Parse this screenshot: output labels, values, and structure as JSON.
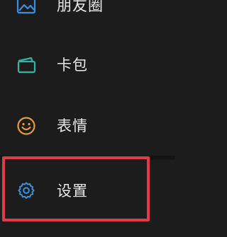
{
  "menu": {
    "items": [
      {
        "label": "朋友圈",
        "icon": "moments-icon"
      },
      {
        "label": "卡包",
        "icon": "card-wallet-icon"
      },
      {
        "label": "表情",
        "icon": "smiley-icon"
      },
      {
        "label": "设置",
        "icon": "gear-icon"
      }
    ]
  },
  "colors": {
    "background": "#1c1c1c",
    "text": "#e8e8e8",
    "moments_icon": "#3b8fe0",
    "cards_icon": "#2fb5a3",
    "emoji_icon": "#e89a3c",
    "settings_icon": "#3b8fe0",
    "highlight": "#e3394a"
  }
}
